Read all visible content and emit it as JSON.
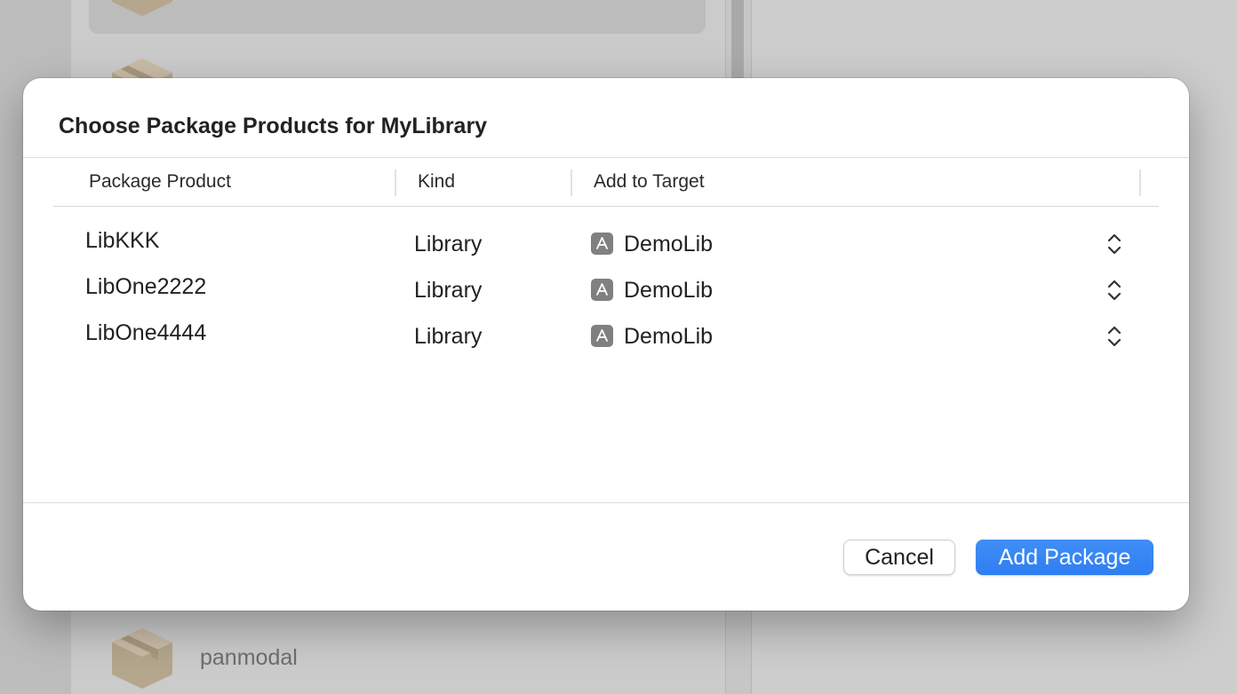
{
  "background": {
    "package_label": "panmodal"
  },
  "dialog": {
    "title": "Choose Package Products for MyLibrary",
    "columns": {
      "product": "Package Product",
      "kind": "Kind",
      "target": "Add to Target"
    },
    "rows": [
      {
        "product": "LibKKK",
        "kind": "Library",
        "target": "DemoLib"
      },
      {
        "product": "LibOne2222",
        "kind": "Library",
        "target": "DemoLib"
      },
      {
        "product": "LibOne4444",
        "kind": "Library",
        "target": "DemoLib"
      }
    ],
    "buttons": {
      "cancel": "Cancel",
      "add": "Add Package"
    }
  },
  "colors": {
    "accent": "#3685f5",
    "package_icon": "#b5a68e"
  },
  "icons": {
    "package": "package-box-icon",
    "target": "app-target-icon",
    "stepper": "up-down-chevron-icon"
  }
}
